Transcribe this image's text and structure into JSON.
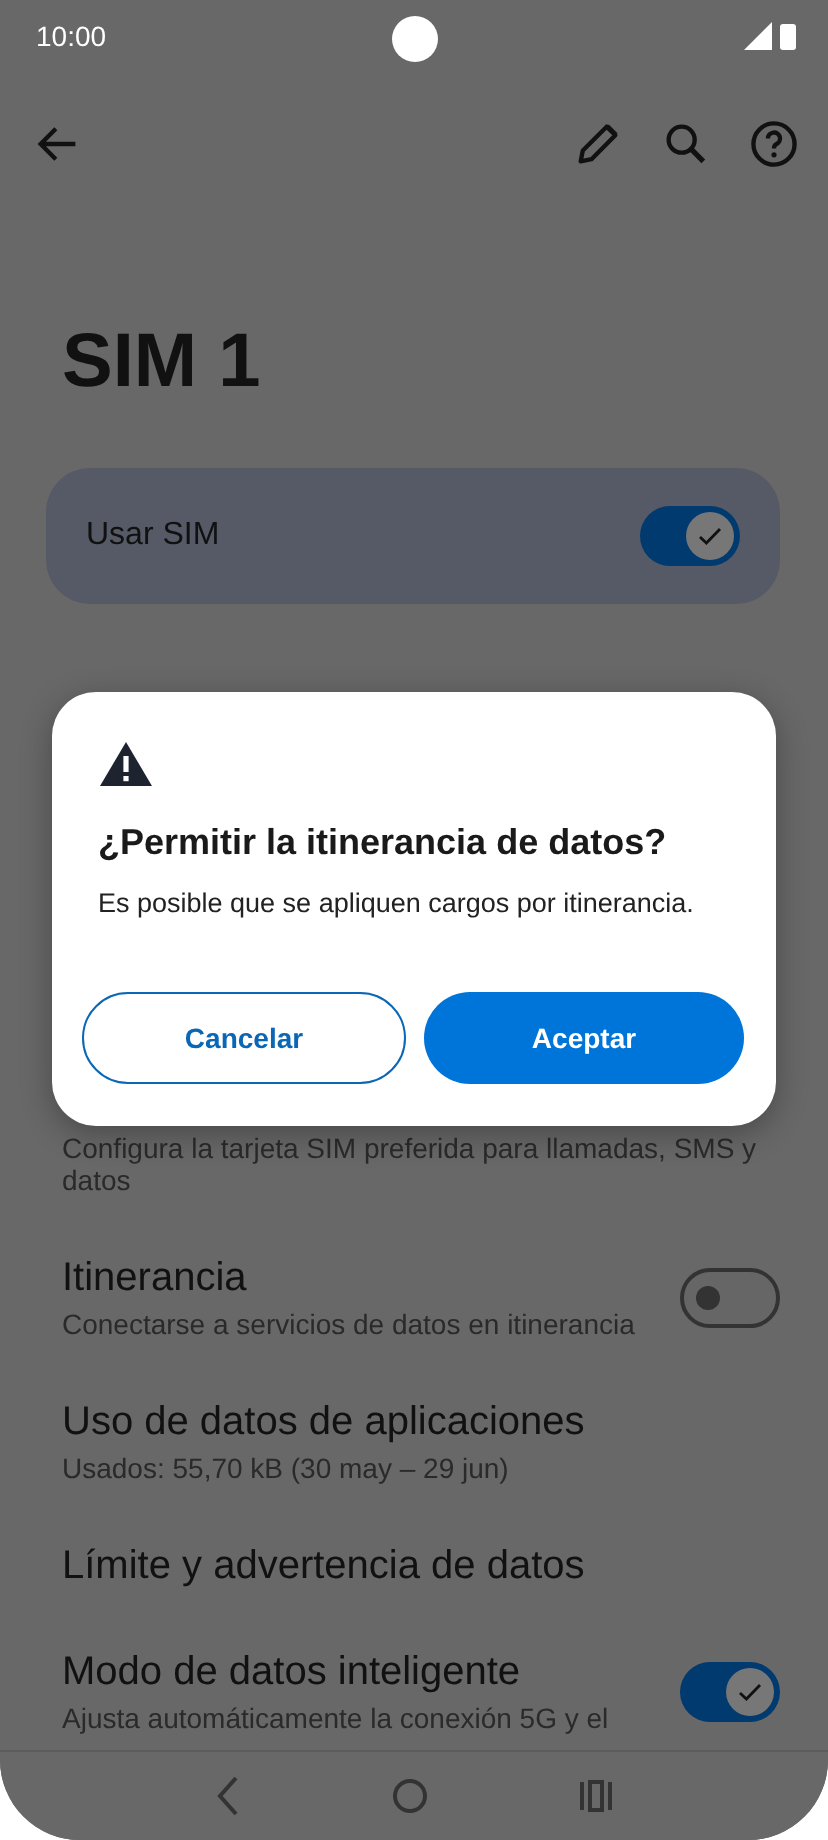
{
  "status_bar": {
    "time": "10:00"
  },
  "title": "SIM 1",
  "use_sim": {
    "label": "Usar SIM",
    "on": true
  },
  "partial_subtitle": "Configura la tarjeta SIM preferida para llamadas, SMS y datos",
  "settings": [
    {
      "kind": "toggle",
      "title": "Itinerancia",
      "subtitle": "Conectarse a servicios de datos en itinerancia",
      "on": false
    },
    {
      "kind": "text",
      "title": "Uso de datos de aplicaciones",
      "subtitle": "Usados: 55,70 kB (30 may – 29 jun)"
    },
    {
      "kind": "text",
      "title": "Límite y advertencia de datos"
    },
    {
      "kind": "toggle",
      "title": "Modo de datos inteligente",
      "subtitle": "Ajusta automáticamente la conexión 5G y el",
      "on": true
    }
  ],
  "dialog": {
    "title": "¿Permitir la itinerancia de datos?",
    "message": "Es posible que se apliquen cargos por itinerancia.",
    "buttons": [
      {
        "label": "Cancelar",
        "kind": "outlined"
      },
      {
        "label": "Aceptar",
        "kind": "filled"
      }
    ]
  }
}
